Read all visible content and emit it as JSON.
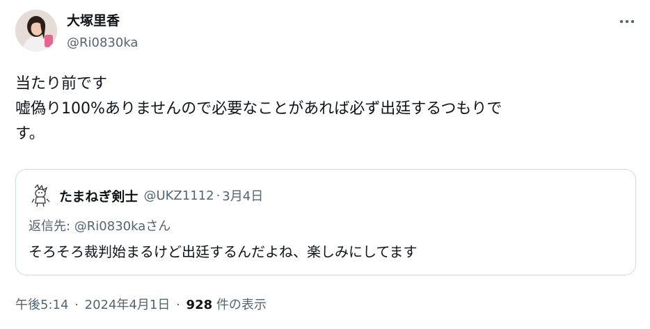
{
  "author": {
    "name": "大塚里香",
    "handle": "@Ri0830ka"
  },
  "tweet": {
    "lines": [
      "当たり前です",
      "嘘偽り100%ありませんので必要なことがあれば必ず出廷するつもりで",
      "す。"
    ]
  },
  "quote": {
    "name": "たまねぎ剣士",
    "handle": "@UKZ1112",
    "separator": "·",
    "date": "3月4日",
    "reply_label": "返信先: @Ri0830kaさん",
    "text": "そろそろ裁判始まるけど出廷するんだよね、楽しみにしてます"
  },
  "footer": {
    "time": "午後5:14",
    "separator": "·",
    "date": "2024年4月1日",
    "views_count": "928",
    "views_label": "件の表示"
  },
  "icons": {
    "more": "more-horizontal-icon",
    "avatar": "user-avatar",
    "quote_avatar": "cartoon-avatar"
  },
  "colors": {
    "text": "#0f1419",
    "secondary": "#536471",
    "border": "#cfd9de"
  }
}
